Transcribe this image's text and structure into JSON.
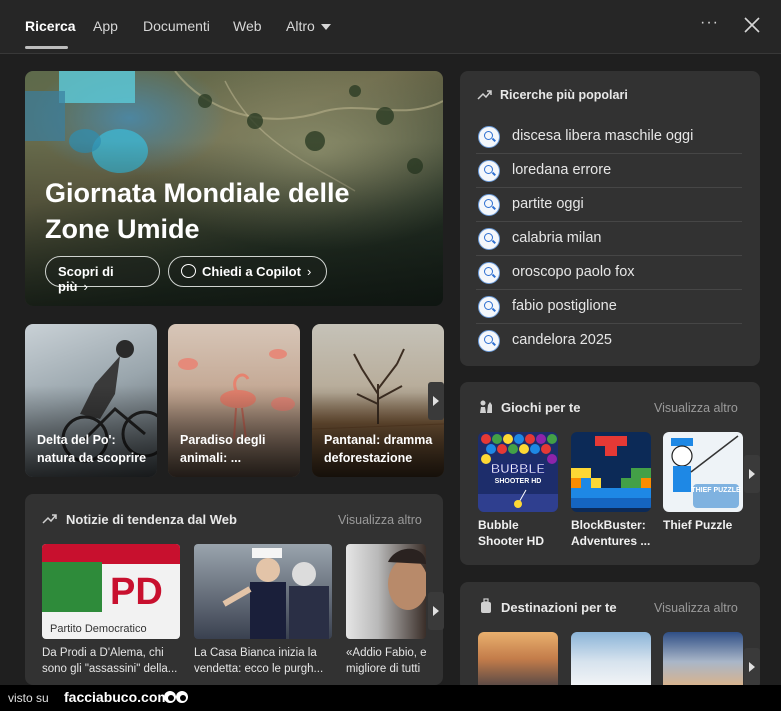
{
  "tabs": [
    {
      "label": "Ricerca",
      "active": true
    },
    {
      "label": "App"
    },
    {
      "label": "Documenti"
    },
    {
      "label": "Web"
    },
    {
      "label": "Altro"
    }
  ],
  "hero": {
    "title": "Giornata Mondiale delle Zone Umide",
    "learn_more": "Scopri di più",
    "ask_copilot": "Chiedi a Copilot"
  },
  "tiles": [
    {
      "label": "Delta del Po': natura da scoprire"
    },
    {
      "label": "Paradiso degli animali: ..."
    },
    {
      "label": "Pantanal: dramma deforestazione"
    }
  ],
  "trending": {
    "title": "Ricerche più popolari",
    "items": [
      "discesa libera maschile oggi",
      "loredana errore",
      "partite oggi",
      "calabria milan",
      "oroscopo paolo fox",
      "fabio postiglione",
      "candelora 2025"
    ]
  },
  "games": {
    "title": "Giochi per te",
    "see_more": "Visualizza altro",
    "items": [
      {
        "label": "Bubble Shooter HD",
        "art_text": "BUBBLE",
        "art_subtext": "SHOOTER HD"
      },
      {
        "label": "BlockBuster: Adventures ..."
      },
      {
        "label": "Thief Puzzle",
        "art_text": "THIEF PUZZLE"
      }
    ]
  },
  "news": {
    "title": "Notizie di tendenza dal Web",
    "see_more": "Visualizza altro",
    "items": [
      {
        "label": "Da Prodi a D'Alema, chi sono gli \"assassini\" della...",
        "art_text": "PD",
        "art_subtext": "Partito Democratico"
      },
      {
        "label": "La Casa Bianca inizia la vendetta: ecco le purgh..."
      },
      {
        "label": "«Addio Fabio, e migliore di tutti"
      }
    ]
  },
  "destinations": {
    "title": "Destinazioni per te",
    "see_more": "Visualizza altro"
  },
  "footer": {
    "prefix": "visto su",
    "brand": "facciabuco.com"
  },
  "colors": {
    "background": "#1f1f1f",
    "card": "#323232",
    "accent_search": "#2d6fd1"
  }
}
